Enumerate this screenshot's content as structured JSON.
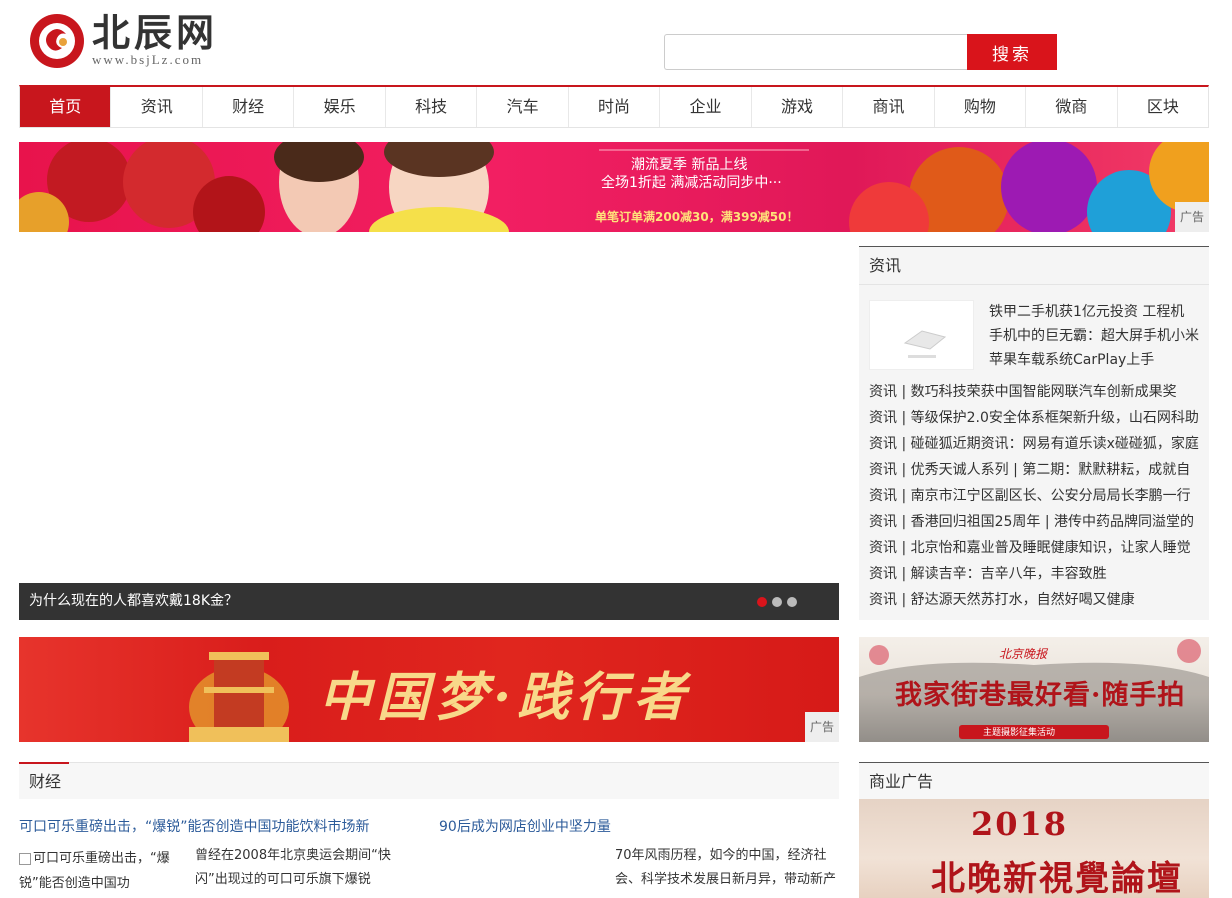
{
  "header": {
    "logo_title": "北辰网",
    "logo_url": "www.bsjLz.com",
    "search_placeholder": "",
    "search_button": "搜索"
  },
  "nav": [
    "首页",
    "资讯",
    "财经",
    "娱乐",
    "科技",
    "汽车",
    "时尚",
    "企业",
    "游戏",
    "商讯",
    "购物",
    "微商",
    "区块"
  ],
  "banner_top": {
    "line1": "潮流夏季  新品上线",
    "line2": "全场1折起  满减活动同步中···",
    "line3": "单笔订单满200减30，满399减50！",
    "ad_label": "广告"
  },
  "slider": {
    "caption": "为什么现在的人都喜欢戴18K金？"
  },
  "banner_mid": {
    "text": "中国梦·践行者",
    "ad_label": "广告"
  },
  "finance": {
    "title": "财经",
    "link1": "可口可乐重磅出击，“爆锐”能否创造中国功能饮料市场新",
    "link2": "90后成为网店创业中坚力量",
    "img_alt": "可口可乐重磅出击，“爆锐”能否创造中国功",
    "text1": "曾经在2008年北京奥运会期间“快闪”出现过的可口可乐旗下爆锐",
    "text2": "70年风雨历程，如今的中国，经济社会、科学技术发展日新月异，带动新产"
  },
  "news": {
    "title": "资讯",
    "featured": [
      "铁甲二手机获1亿元投资 工程机",
      "手机中的巨无霸：超大屏手机小米",
      "苹果车载系统CarPlay上手"
    ],
    "items": [
      "资讯 | 数巧科技荣获中国智能网联汽车创新成果奖",
      "资讯 | 等级保护2.0安全体系框架新升级，山石网科助",
      "资讯 | 碰碰狐近期资讯：网易有道乐读x碰碰狐，家庭",
      "资讯 | 优秀天诚人系列 | 第二期：默默耕耘，成就自",
      "资讯 | 南京市江宁区副区长、公安分局局长李鹏一行",
      "资讯 | 香港回归祖国25周年 | 港传中药品牌同溢堂的",
      "资讯 | 北京怡和嘉业普及睡眠健康知识，让家人睡觉",
      "资讯 | 解读吉辛：吉辛八年，丰容致胜",
      "资讯 | 舒达源天然苏打水，自然好喝又健康"
    ]
  },
  "side_ad1": {
    "text": "我家街巷最好看·随手拍",
    "sub": "主题摄影征集活动",
    "top": "北京晚报"
  },
  "biz_ad": {
    "title": "商业广告",
    "year": "2018",
    "text": "北晚新視覺論壇"
  }
}
